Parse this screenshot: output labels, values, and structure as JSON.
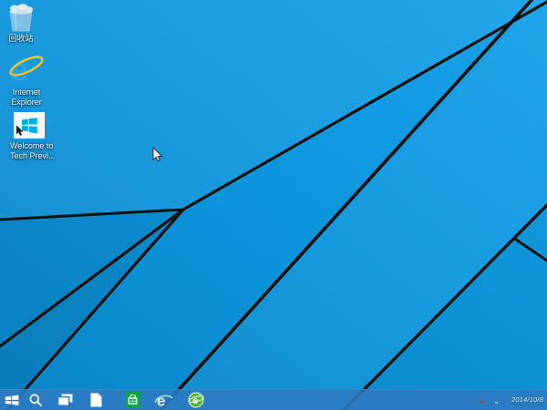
{
  "desktop": {
    "wallpaper_name": "windows-technical-preview-blue-rays",
    "icons": [
      {
        "name": "recycle-bin",
        "label": "回收站"
      },
      {
        "name": "internet-explorer",
        "label_line1": "Internet",
        "label_line2": "Explorer"
      },
      {
        "name": "welcome-to-tech-preview",
        "label_line1": "Welcome to",
        "label_line2": "Tech Previ..."
      }
    ]
  },
  "taskbar": {
    "buttons": [
      {
        "icon": "start-icon"
      },
      {
        "icon": "search-icon"
      },
      {
        "icon": "task-view-icon"
      },
      {
        "icon": "document-icon"
      },
      {
        "icon": "windows-store-icon"
      },
      {
        "icon": "internet-explorer-icon"
      },
      {
        "icon": "360-browser-icon"
      }
    ],
    "tray": {
      "date": "2014/10/8"
    }
  },
  "colors": {
    "wallpaper_light": "#18a2ea",
    "wallpaper_mid": "#0d95dc",
    "wallpaper_dark": "#0a85c6",
    "ray_line": "#0b110c",
    "taskbar_blue": "#2d7ac0",
    "store_green": "#0aa53f",
    "ie_blue": "#2aa7e9",
    "ie_swoosh_gold": "#f6c51f",
    "browser360_green": "#55b72f",
    "welcome_flag_blue": "#00adef"
  }
}
